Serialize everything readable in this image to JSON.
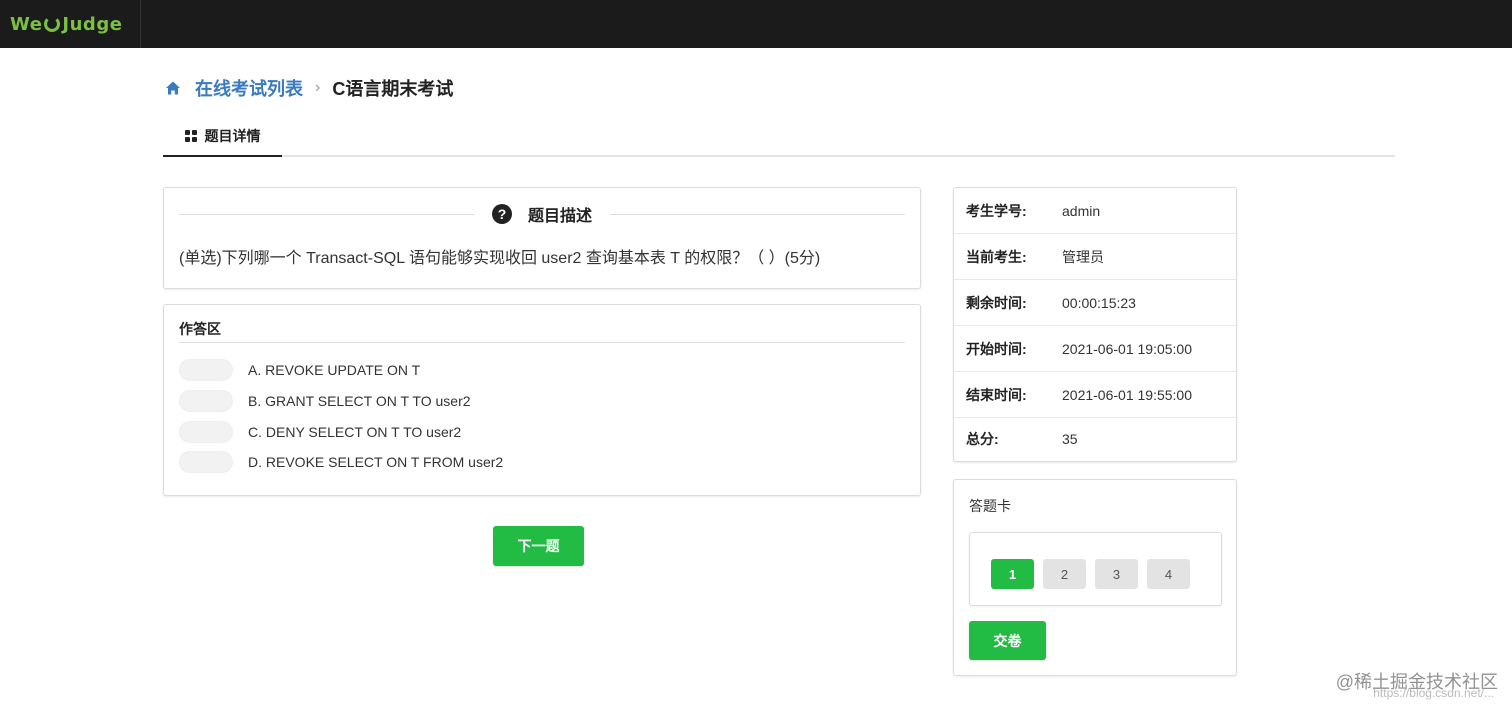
{
  "navbar": {
    "logo_prefix": "We",
    "logo_suffix": "Judge",
    "brand_color": "#7ac143"
  },
  "breadcrumb": {
    "home_icon": "home-icon",
    "link": "在线考试列表",
    "separator": "›",
    "current": "C语言期末考试"
  },
  "tabs": [
    {
      "label": "题目详情",
      "icon": "grid-icon",
      "active": true
    }
  ],
  "question": {
    "title": "题目描述",
    "icon": "question-circle-icon",
    "text": "(单选)下列哪一个 Transact-SQL 语句能够实现收回 user2 查询基本表 T 的权限？（   ）(5分)"
  },
  "answer_area": {
    "title": "作答区",
    "options": [
      {
        "label": "A.  REVOKE UPDATE ON T"
      },
      {
        "label": "B.  GRANT SELECT ON T TO user2"
      },
      {
        "label": "C.  DENY SELECT ON T TO user2"
      },
      {
        "label": "D.  REVOKE SELECT ON T FROM user2"
      }
    ]
  },
  "next_button": "下一题",
  "info": [
    {
      "label": "考生学号:",
      "value": "admin"
    },
    {
      "label": "当前考生:",
      "value": "管理员"
    },
    {
      "label": "剩余时间:",
      "value": "00:00:15:23"
    },
    {
      "label": "开始时间:",
      "value": "2021-06-01 19:05:00"
    },
    {
      "label": "结束时间:",
      "value": "2021-06-01 19:55:00"
    },
    {
      "label": "总分:",
      "value": "35"
    }
  ],
  "answer_sheet": {
    "title": "答题卡",
    "questions": [
      {
        "num": "1",
        "active": true
      },
      {
        "num": "2",
        "active": false
      },
      {
        "num": "3",
        "active": false
      },
      {
        "num": "4",
        "active": false
      }
    ],
    "submit": "交卷"
  },
  "colors": {
    "accent_green": "#22bb44",
    "link_blue": "#3a7abf",
    "navbar_bg": "#1b1b1b"
  },
  "watermark": {
    "main": "@稀土掘金技术社区",
    "sub": "https://blog.csdn.net/..."
  }
}
